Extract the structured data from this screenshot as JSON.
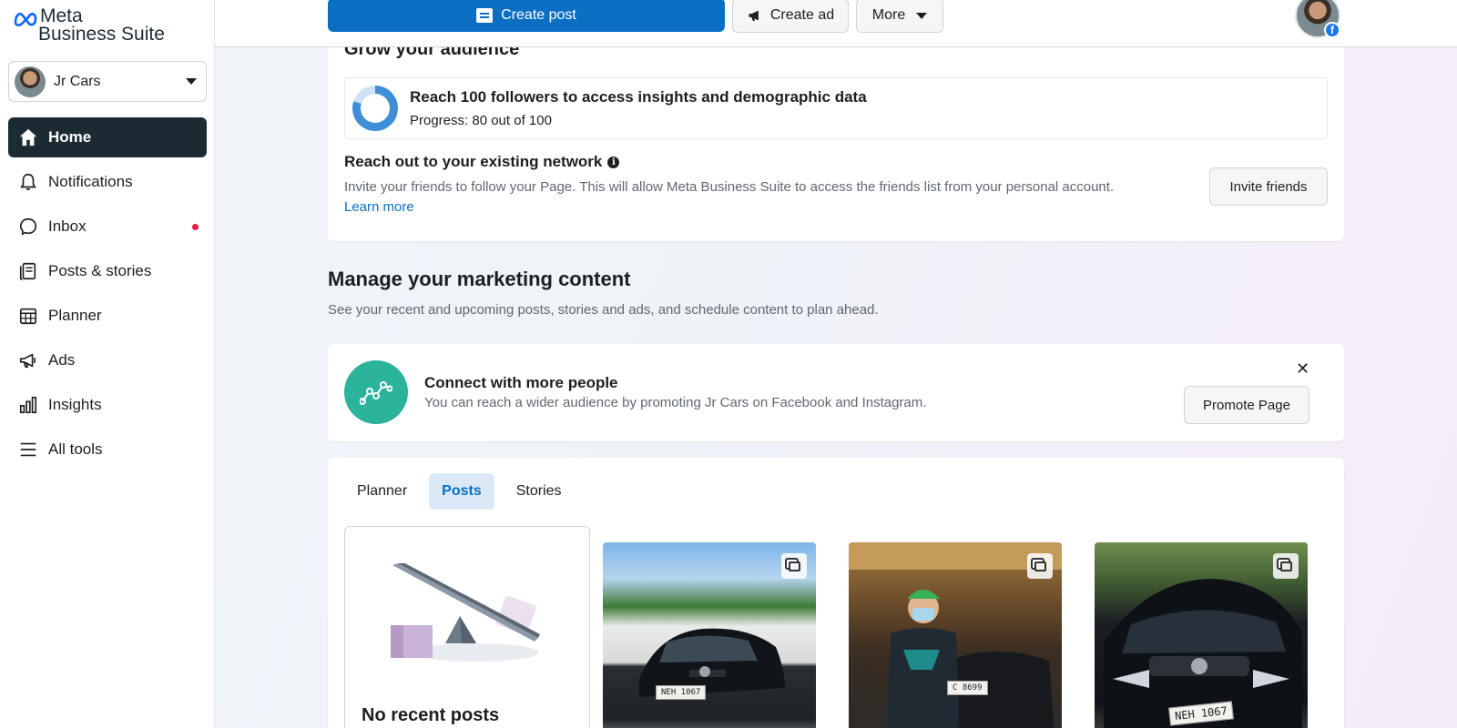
{
  "brand": {
    "line1": "Meta",
    "line2": "Business Suite"
  },
  "account": {
    "name": "Jr Cars"
  },
  "nav": {
    "items": [
      {
        "label": "Home",
        "icon": "home-icon",
        "active": true
      },
      {
        "label": "Notifications",
        "icon": "bell-icon"
      },
      {
        "label": "Inbox",
        "icon": "chat-icon",
        "has_dot": true
      },
      {
        "label": "Posts & stories",
        "icon": "posts-icon"
      },
      {
        "label": "Planner",
        "icon": "calendar-icon"
      },
      {
        "label": "Ads",
        "icon": "megaphone-icon"
      },
      {
        "label": "Insights",
        "icon": "bar-chart-icon"
      },
      {
        "label": "All tools",
        "icon": "menu-icon"
      }
    ]
  },
  "toolbar": {
    "create_post": "Create post",
    "create_ad": "Create ad",
    "more": "More"
  },
  "grow": {
    "title": "Grow your audience",
    "reach_title": "Reach 100 followers to access insights and demographic data",
    "reach_progress": "Progress: 80 out of 100",
    "progress_value": 80,
    "progress_max": 100,
    "network_title": "Reach out to your existing network",
    "network_desc": "Invite your friends to follow your Page. This will allow Meta Business Suite to access the friends list from your personal account.",
    "learn_more": "Learn more",
    "invite_button": "Invite friends"
  },
  "manage": {
    "title": "Manage your marketing content",
    "desc": "See your recent and upcoming posts, stories and ads, and schedule content to plan ahead."
  },
  "connect": {
    "title": "Connect with more people",
    "desc": "You can reach a wider audience by promoting Jr Cars on Facebook and Instagram.",
    "promote_button": "Promote Page",
    "close": "✕"
  },
  "posts": {
    "tabs": [
      "Planner",
      "Posts",
      "Stories"
    ],
    "active_tab": "Posts",
    "empty_title": "No recent posts",
    "thumbnails": [
      {
        "plate": "NEH 1067"
      },
      {
        "plate": "C 8699"
      },
      {
        "plate": "NEH 1067"
      }
    ]
  },
  "colors": {
    "primary": "#0a6fc2",
    "sidebar_active": "#1c2b33",
    "accent_teal": "#2bb39b",
    "notification_dot": "#e41e3f"
  }
}
